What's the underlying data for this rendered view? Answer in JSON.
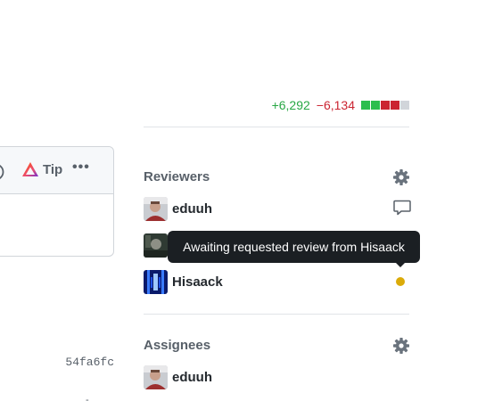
{
  "diffstat": {
    "additions": "+6,292",
    "deletions": "−6,134",
    "blocks": [
      "green",
      "green",
      "red",
      "red",
      "gray"
    ]
  },
  "comment_toolbar": {
    "tip_label": "Tip",
    "more_label": "•••"
  },
  "timeline": {
    "commit_sha": "54fa6fc",
    "trailing_mark": "-"
  },
  "reviewers": {
    "heading": "Reviewers",
    "people": [
      {
        "name": "eduuh",
        "status_icon": "comment-icon"
      },
      {
        "name": "",
        "status_icon": "none"
      },
      {
        "name": "Hisaack",
        "status_icon": "pending-dot",
        "status_color": "#dbab09"
      }
    ],
    "tooltip": "Awaiting requested review from Hisaack"
  },
  "assignees": {
    "heading": "Assignees",
    "people": [
      {
        "name": "eduuh"
      }
    ]
  },
  "colors": {
    "add": "#28a745",
    "delete": "#cb2431",
    "pending": "#dbab09",
    "tooltip_bg": "#1b1f23"
  }
}
